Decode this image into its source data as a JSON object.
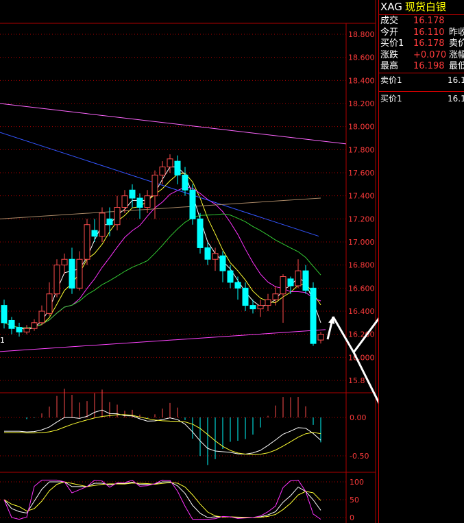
{
  "panel": {
    "code": "XAG",
    "name": "现货白银",
    "quotes": [
      {
        "label": "成交",
        "value": "16.178",
        "label2": ""
      },
      {
        "label": "今开",
        "value": "16.110",
        "label2": "昨收"
      },
      {
        "label": "买价1",
        "value": "16.178",
        "label2": "卖价"
      },
      {
        "label": "涨跌",
        "value": "+0.070",
        "label2": "涨幅"
      },
      {
        "label": "最高",
        "value": "16.198",
        "label2": "最低"
      }
    ],
    "orderbook": [
      {
        "label": "卖价1",
        "value": "16.1"
      },
      {
        "label": "买价1",
        "value": "16.1"
      }
    ]
  },
  "colors": {
    "up": "#ff4d4d",
    "down": "#00ffff",
    "grid": "#b00000",
    "axis_text": "#ff3b3b"
  },
  "chart_data": [
    {
      "type": "candlestick",
      "title": "",
      "ylim": [
        15.85,
        18.95
      ],
      "yticks": [
        "18.800",
        "18.600",
        "18.400",
        "18.200",
        "18.000",
        "17.800",
        "17.600",
        "17.400",
        "17.200",
        "17.000",
        "16.800",
        "16.600",
        "16.400",
        "16.200",
        "16.000",
        "15.8"
      ],
      "ytick_values": [
        18.8,
        18.6,
        18.4,
        18.2,
        18.0,
        17.8,
        17.6,
        17.4,
        17.2,
        17.0,
        16.8,
        16.6,
        16.4,
        16.2,
        16.0,
        15.8
      ],
      "left_label": "1",
      "candles": [
        [
          16.45,
          16.3,
          16.5,
          16.25
        ],
        [
          16.32,
          16.25,
          16.35,
          16.2
        ],
        [
          16.26,
          16.22,
          16.3,
          16.18
        ],
        [
          16.22,
          16.25,
          16.28,
          16.2
        ],
        [
          16.25,
          16.3,
          16.33,
          16.23
        ],
        [
          16.3,
          16.4,
          16.45,
          16.28
        ],
        [
          16.38,
          16.55,
          16.65,
          16.36
        ],
        [
          16.55,
          16.8,
          16.85,
          16.52
        ],
        [
          16.8,
          16.85,
          16.9,
          16.72
        ],
        [
          16.85,
          16.6,
          16.95,
          16.55
        ],
        [
          16.6,
          16.85,
          16.92,
          16.58
        ],
        [
          16.85,
          17.15,
          17.2,
          16.8
        ],
        [
          17.1,
          17.05,
          17.2,
          17.0
        ],
        [
          17.05,
          17.25,
          17.3,
          17.0
        ],
        [
          17.2,
          17.15,
          17.3,
          17.05
        ],
        [
          17.15,
          17.3,
          17.4,
          17.1
        ],
        [
          17.3,
          17.4,
          17.45,
          17.25
        ],
        [
          17.45,
          17.38,
          17.5,
          17.3
        ],
        [
          17.38,
          17.3,
          17.42,
          17.2
        ],
        [
          17.3,
          17.4,
          17.45,
          17.25
        ],
        [
          17.4,
          17.58,
          17.62,
          17.2
        ],
        [
          17.58,
          17.65,
          17.7,
          17.5
        ],
        [
          17.65,
          17.72,
          17.76,
          17.6
        ],
        [
          17.7,
          17.58,
          17.75,
          17.5
        ],
        [
          17.58,
          17.45,
          17.65,
          17.4
        ],
        [
          17.45,
          17.2,
          17.5,
          17.15
        ],
        [
          17.2,
          16.95,
          17.25,
          16.9
        ],
        [
          16.95,
          16.85,
          17.0,
          16.8
        ],
        [
          16.85,
          16.9,
          16.95,
          16.75
        ],
        [
          16.88,
          16.75,
          16.92,
          16.65
        ],
        [
          16.75,
          16.65,
          16.8,
          16.6
        ],
        [
          16.65,
          16.6,
          16.7,
          16.5
        ],
        [
          16.6,
          16.45,
          16.65,
          16.4
        ],
        [
          16.45,
          16.42,
          16.5,
          16.38
        ],
        [
          16.42,
          16.45,
          16.5,
          16.35
        ],
        [
          16.45,
          16.5,
          16.55,
          16.4
        ],
        [
          16.5,
          16.55,
          16.62,
          16.45
        ],
        [
          16.55,
          16.7,
          16.72,
          16.3
        ],
        [
          16.68,
          16.62,
          16.7,
          16.55
        ],
        [
          16.62,
          16.75,
          16.85,
          16.6
        ],
        [
          16.75,
          16.58,
          16.8,
          16.55
        ],
        [
          16.6,
          16.12,
          16.65,
          16.1
        ],
        [
          16.15,
          16.2,
          16.22,
          16.12
        ]
      ]
    },
    {
      "type": "bar",
      "title": "",
      "yticks": [
        "0.00",
        "-0.50"
      ],
      "ytick_values": [
        0.0,
        -0.5
      ],
      "ylim": [
        -0.6,
        0.25
      ]
    },
    {
      "type": "line",
      "title": "",
      "yticks": [
        "100",
        "50",
        "0"
      ],
      "ytick_values": [
        100,
        50,
        0
      ],
      "ylim": [
        -8,
        108
      ]
    }
  ]
}
